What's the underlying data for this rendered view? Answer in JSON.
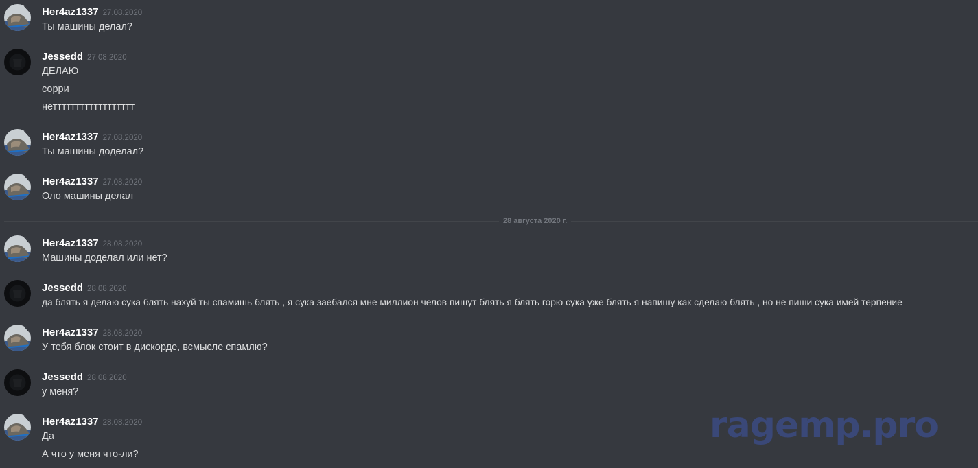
{
  "messages": [
    {
      "author": "Her4az1337",
      "avatar": "avatar-her4az",
      "time": "27.08.2020",
      "lines": [
        "Ты машины делал?"
      ]
    },
    {
      "author": "Jessedd",
      "avatar": "avatar-jessedd",
      "time": "27.08.2020",
      "lines": [
        "ДЕЛАЮ",
        "сорри",
        "нетттттттттттттттттт"
      ]
    },
    {
      "author": "Her4az1337",
      "avatar": "avatar-her4az",
      "time": "27.08.2020",
      "lines": [
        "Ты машины доделал?"
      ]
    },
    {
      "author": "Her4az1337",
      "avatar": "avatar-her4az",
      "time": "27.08.2020",
      "lines": [
        "Оло машины делал"
      ]
    },
    {
      "author": "Her4az1337",
      "avatar": "avatar-her4az",
      "time": "28.08.2020",
      "lines": [
        "Машины доделал или нет?"
      ]
    },
    {
      "author": "Jessedd",
      "avatar": "avatar-jessedd",
      "time": "28.08.2020",
      "lines": [
        "да блять я делаю сука блять нахуй ты спамишь блять , я сука заебался мне миллион челов пишут блять я блять горю сука уже блять я напишу как сделаю блять , но не пиши сука имей терпение"
      ]
    },
    {
      "author": "Her4az1337",
      "avatar": "avatar-her4az",
      "time": "28.08.2020",
      "lines": [
        "У тебя блок стоит в дискорде, всмысле спамлю?"
      ]
    },
    {
      "author": "Jessedd",
      "avatar": "avatar-jessedd",
      "time": "28.08.2020",
      "lines": [
        "у меня?"
      ]
    },
    {
      "author": "Her4az1337",
      "avatar": "avatar-her4az",
      "time": "28.08.2020",
      "lines": [
        "Да",
        "А что у меня что-ли?"
      ]
    }
  ],
  "date_divider": "28 августа 2020 г.",
  "watermark": "ragemp.pro",
  "colors": {
    "background": "#36393f",
    "username": "#ffffff",
    "message_text": "#dcddde",
    "timestamp": "#72767d",
    "watermark": "#3a4878"
  }
}
